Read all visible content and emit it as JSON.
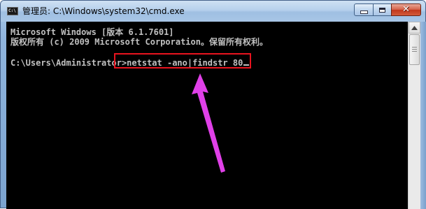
{
  "window": {
    "icon_label": "C:\\",
    "title": "管理员: C:\\Windows\\system32\\cmd.exe"
  },
  "controls": {
    "minimize": "minimize",
    "maximize": "maximize",
    "close": "✕"
  },
  "console": {
    "lines": [
      "Microsoft Windows [版本 6.1.7601]",
      "版权所有 (c) 2009 Microsoft Corporation。保留所有权利。",
      "",
      "C:\\Users\\Administrator>netstat -ano|findstr 80"
    ]
  },
  "annotation": {
    "highlight_color": "#e8131e",
    "arrow_color": "#e040e8"
  }
}
